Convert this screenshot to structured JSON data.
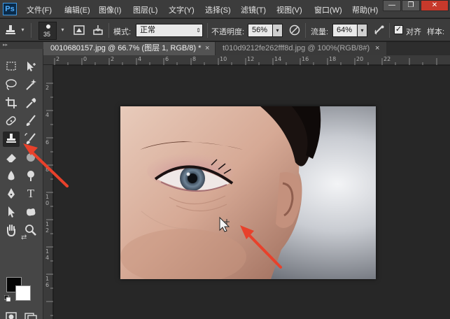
{
  "app": {
    "logo": "Ps"
  },
  "menu": [
    "文件(F)",
    "编辑(E)",
    "图像(I)",
    "图层(L)",
    "文字(Y)",
    "选择(S)",
    "滤镜(T)",
    "视图(V)",
    "窗口(W)",
    "帮助(H)"
  ],
  "window_controls": {
    "minimize": "—",
    "restore": "❐",
    "close": "✕"
  },
  "options_bar": {
    "brush_size": "35",
    "mode_label": "模式:",
    "mode_value": "正常",
    "opacity_label": "不透明度:",
    "opacity_value": "56%",
    "flow_label": "流量:",
    "flow_value": "64%",
    "aligned_label": "对齐",
    "sample_label": "样本:"
  },
  "tabs": [
    {
      "title": "0010680157.jpg @ 66.7% (图层 1, RGB/8) *",
      "active": true
    },
    {
      "title": "t010d9212fe262fff8d.jpg @ 100%(RGB/8#)",
      "active": false
    }
  ],
  "tab_close_glyph": "×",
  "ruler_top_numbers": [
    "2",
    "0",
    "2",
    "4",
    "6",
    "8",
    "10",
    "12",
    "14",
    "16",
    "18",
    "20",
    "22"
  ],
  "ruler_left_numbers": [
    "2",
    "4",
    "6",
    "8",
    "1 0",
    "1 2",
    "1 4",
    "1 6"
  ],
  "icons": {
    "stamp_tool": "clone-stamp-icon",
    "selected_tool": "clone-stamp-tool"
  },
  "colors": {
    "foreground": "#050505",
    "background": "#ffffff",
    "annotation_arrow": "#e8412b"
  }
}
